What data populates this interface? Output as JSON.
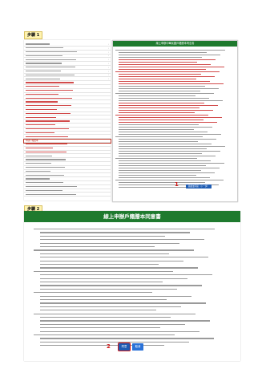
{
  "step1_label": "步驟 1",
  "step2_label": "步驟 2",
  "marker1": "1",
  "marker2": "2",
  "panel": {
    "header": "線上申辦中華民國戶籍謄本同意書",
    "agree_button": "閱讀並同意（下一步）"
  },
  "document": {
    "header": "線上申辦戶籍謄本同意書"
  },
  "buttons": {
    "agree": "同意",
    "cancel": "取消"
  },
  "sidebar": {
    "highlighted_item": "申請戶籍謄本"
  },
  "colors": {
    "header_green": "#1f7a2e",
    "button_blue": "#1e5cb3",
    "marker_red": "#d11a1a"
  }
}
